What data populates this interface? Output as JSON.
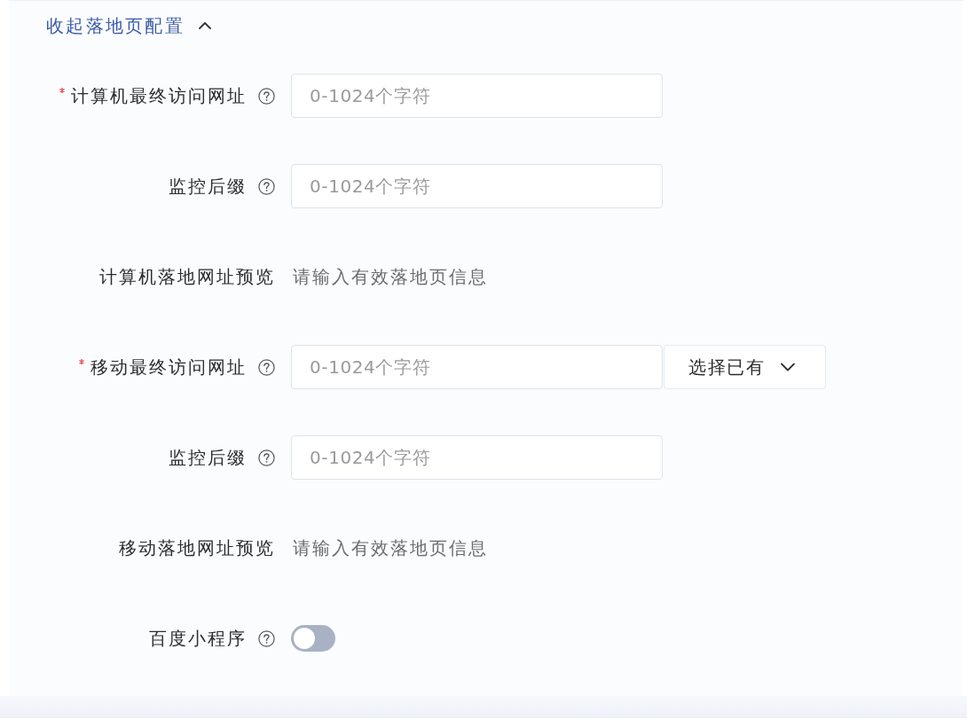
{
  "collapse_toggle": {
    "label": "收起落地页配置",
    "expanded": true
  },
  "fields": [
    {
      "kind": "input",
      "label": "计算机最终访问网址",
      "required": true,
      "help": true,
      "placeholder": "0-1024个字符"
    },
    {
      "kind": "input",
      "label": "监控后缀",
      "required": false,
      "help": true,
      "placeholder": "0-1024个字符"
    },
    {
      "kind": "preview",
      "label": "计算机落地网址预览",
      "required": false,
      "help": false,
      "value": "请输入有效落地页信息"
    },
    {
      "kind": "input",
      "label": "移动最终访问网址",
      "required": true,
      "help": true,
      "placeholder": "0-1024个字符",
      "select": {
        "label": "选择已有"
      }
    },
    {
      "kind": "input",
      "label": "监控后缀",
      "required": false,
      "help": true,
      "placeholder": "0-1024个字符"
    },
    {
      "kind": "preview",
      "label": "移动落地网址预览",
      "required": false,
      "help": false,
      "value": "请输入有效落地页信息"
    },
    {
      "kind": "switch",
      "label": "百度小程序",
      "required": false,
      "help": true,
      "on": false
    }
  ]
}
